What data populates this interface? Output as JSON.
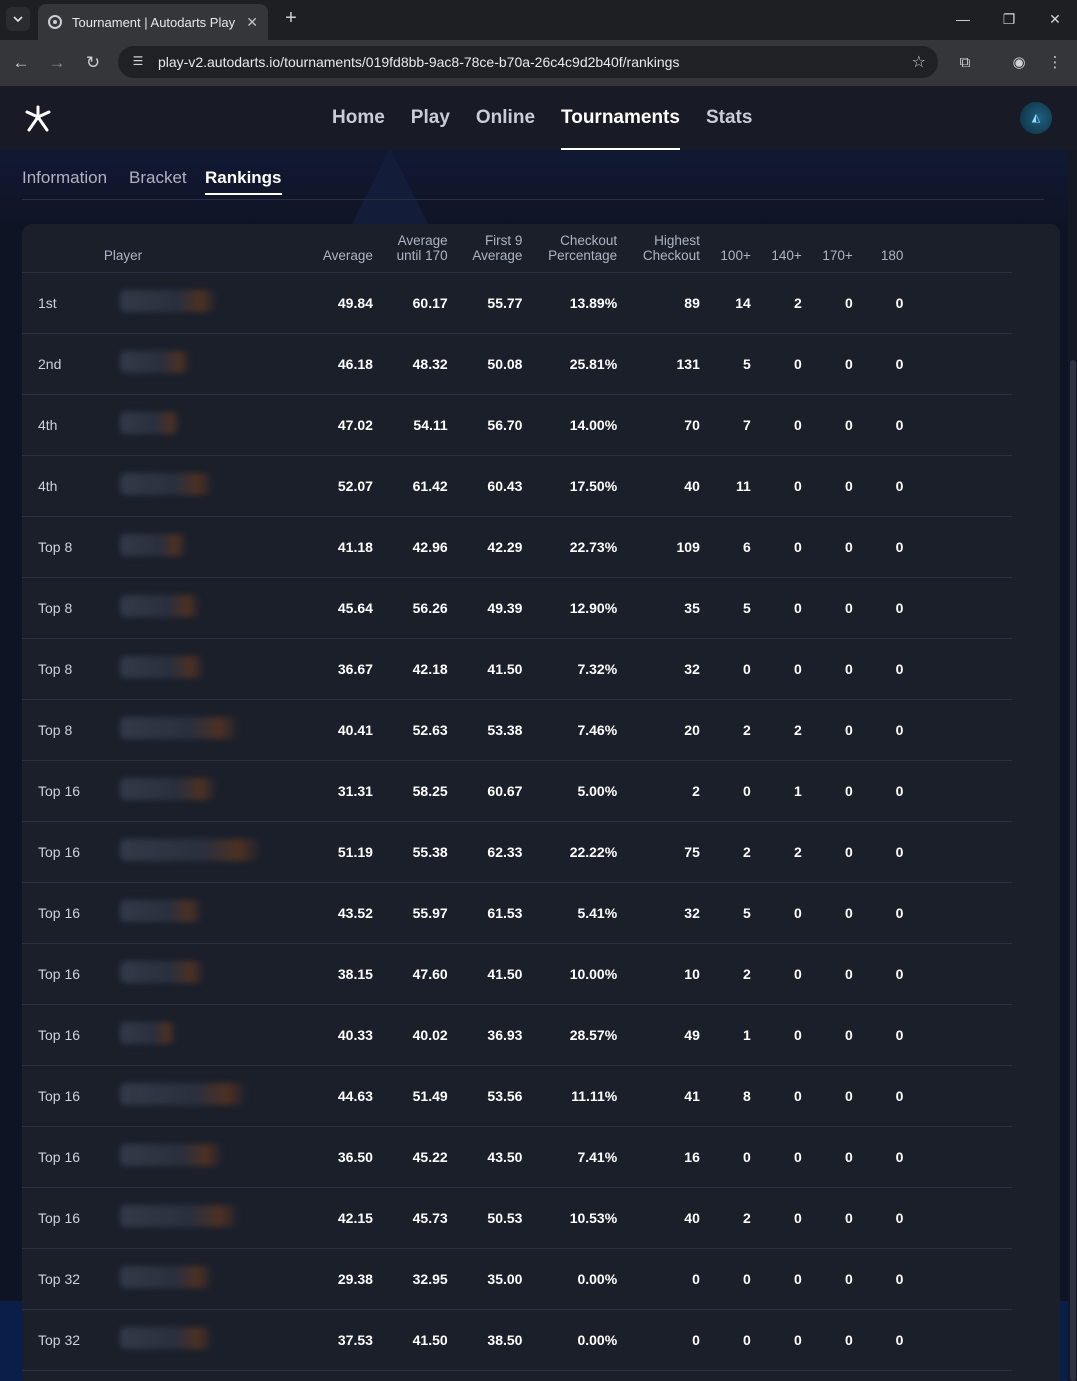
{
  "browser": {
    "tab_title": "Tournament | Autodarts Play",
    "new_tab": "+",
    "url": "play-v2.autodarts.io/tournaments/019fd8bb-9ac8-78ce-b70a-26c4c9d2b40f/rankings",
    "window_controls": [
      "minimize-icon",
      "restore-icon",
      "close-icon"
    ]
  },
  "header": {
    "nav": [
      "Home",
      "Play",
      "Online",
      "Tournaments",
      "Stats"
    ],
    "active_nav": "Tournaments"
  },
  "subtabs": {
    "items": [
      "Information",
      "Bracket",
      "Rankings"
    ],
    "active": "Rankings"
  },
  "table": {
    "columns": {
      "player": "Player",
      "average": "Average",
      "average_until_170_l1": "Average",
      "average_until_170_l2": "until 170",
      "first9_l1": "First 9",
      "first9_l2": "Average",
      "checkout_l1": "Checkout",
      "checkout_l2": "Percentage",
      "highest_l1": "Highest",
      "highest_l2": "Checkout",
      "c100": "100+",
      "c140": "140+",
      "c170": "170+",
      "c180": "180"
    },
    "rows": [
      {
        "rank": "1st",
        "avg": "49.84",
        "avg170": "60.17",
        "first9": "55.77",
        "co_pct": "13.89%",
        "hi_co": "89",
        "c100": "14",
        "c140": "2",
        "c170": "0",
        "c180": "0"
      },
      {
        "rank": "2nd",
        "avg": "46.18",
        "avg170": "48.32",
        "first9": "50.08",
        "co_pct": "25.81%",
        "hi_co": "131",
        "c100": "5",
        "c140": "0",
        "c170": "0",
        "c180": "0"
      },
      {
        "rank": "4th",
        "avg": "47.02",
        "avg170": "54.11",
        "first9": "56.70",
        "co_pct": "14.00%",
        "hi_co": "70",
        "c100": "7",
        "c140": "0",
        "c170": "0",
        "c180": "0"
      },
      {
        "rank": "4th",
        "avg": "52.07",
        "avg170": "61.42",
        "first9": "60.43",
        "co_pct": "17.50%",
        "hi_co": "40",
        "c100": "11",
        "c140": "0",
        "c170": "0",
        "c180": "0"
      },
      {
        "rank": "Top 8",
        "avg": "41.18",
        "avg170": "42.96",
        "first9": "42.29",
        "co_pct": "22.73%",
        "hi_co": "109",
        "c100": "6",
        "c140": "0",
        "c170": "0",
        "c180": "0"
      },
      {
        "rank": "Top 8",
        "avg": "45.64",
        "avg170": "56.26",
        "first9": "49.39",
        "co_pct": "12.90%",
        "hi_co": "35",
        "c100": "5",
        "c140": "0",
        "c170": "0",
        "c180": "0"
      },
      {
        "rank": "Top 8",
        "avg": "36.67",
        "avg170": "42.18",
        "first9": "41.50",
        "co_pct": "7.32%",
        "hi_co": "32",
        "c100": "0",
        "c140": "0",
        "c170": "0",
        "c180": "0"
      },
      {
        "rank": "Top 8",
        "avg": "40.41",
        "avg170": "52.63",
        "first9": "53.38",
        "co_pct": "7.46%",
        "hi_co": "20",
        "c100": "2",
        "c140": "2",
        "c170": "0",
        "c180": "0"
      },
      {
        "rank": "Top 16",
        "avg": "31.31",
        "avg170": "58.25",
        "first9": "60.67",
        "co_pct": "5.00%",
        "hi_co": "2",
        "c100": "0",
        "c140": "1",
        "c170": "0",
        "c180": "0"
      },
      {
        "rank": "Top 16",
        "avg": "51.19",
        "avg170": "55.38",
        "first9": "62.33",
        "co_pct": "22.22%",
        "hi_co": "75",
        "c100": "2",
        "c140": "2",
        "c170": "0",
        "c180": "0"
      },
      {
        "rank": "Top 16",
        "avg": "43.52",
        "avg170": "55.97",
        "first9": "61.53",
        "co_pct": "5.41%",
        "hi_co": "32",
        "c100": "5",
        "c140": "0",
        "c170": "0",
        "c180": "0"
      },
      {
        "rank": "Top 16",
        "avg": "38.15",
        "avg170": "47.60",
        "first9": "41.50",
        "co_pct": "10.00%",
        "hi_co": "10",
        "c100": "2",
        "c140": "0",
        "c170": "0",
        "c180": "0"
      },
      {
        "rank": "Top 16",
        "avg": "40.33",
        "avg170": "40.02",
        "first9": "36.93",
        "co_pct": "28.57%",
        "hi_co": "49",
        "c100": "1",
        "c140": "0",
        "c170": "0",
        "c180": "0"
      },
      {
        "rank": "Top 16",
        "avg": "44.63",
        "avg170": "51.49",
        "first9": "53.56",
        "co_pct": "11.11%",
        "hi_co": "41",
        "c100": "8",
        "c140": "0",
        "c170": "0",
        "c180": "0"
      },
      {
        "rank": "Top 16",
        "avg": "36.50",
        "avg170": "45.22",
        "first9": "43.50",
        "co_pct": "7.41%",
        "hi_co": "16",
        "c100": "0",
        "c140": "0",
        "c170": "0",
        "c180": "0"
      },
      {
        "rank": "Top 16",
        "avg": "42.15",
        "avg170": "45.73",
        "first9": "50.53",
        "co_pct": "10.53%",
        "hi_co": "40",
        "c100": "2",
        "c140": "0",
        "c170": "0",
        "c180": "0"
      },
      {
        "rank": "Top 32",
        "avg": "29.38",
        "avg170": "32.95",
        "first9": "35.00",
        "co_pct": "0.00%",
        "hi_co": "0",
        "c100": "0",
        "c140": "0",
        "c170": "0",
        "c180": "0"
      },
      {
        "rank": "Top 32",
        "avg": "37.53",
        "avg170": "41.50",
        "first9": "38.50",
        "co_pct": "0.00%",
        "hi_co": "0",
        "c100": "0",
        "c140": "0",
        "c170": "0",
        "c180": "0"
      }
    ]
  }
}
